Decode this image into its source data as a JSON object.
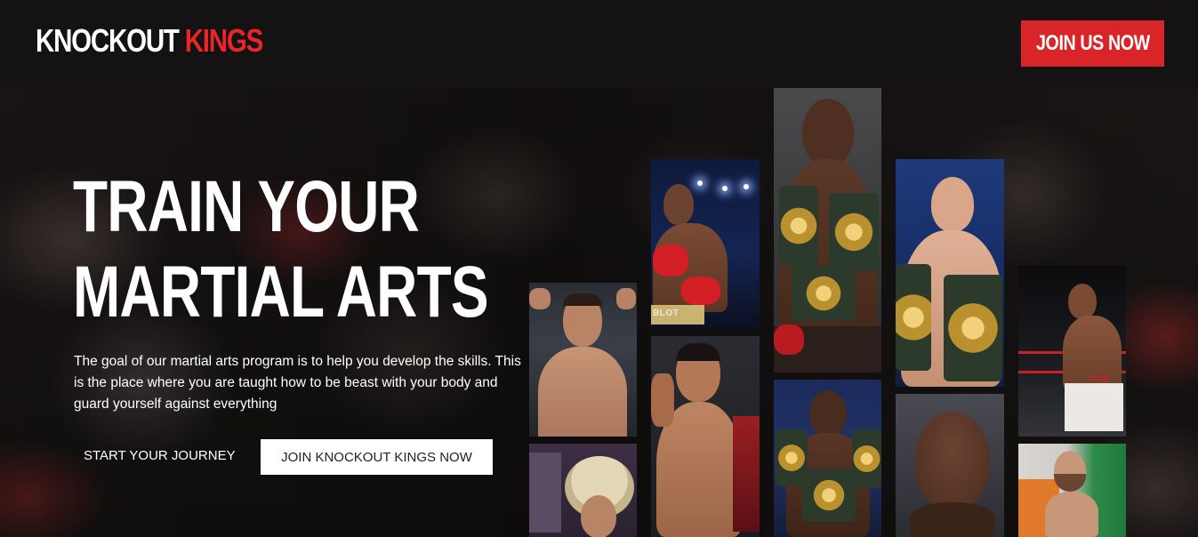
{
  "brand": {
    "logo_part1": "KNOCKOUT",
    "logo_part2": "KINGS",
    "accent_color": "#d92528"
  },
  "header": {
    "join_label": "JOIN US NOW"
  },
  "hero": {
    "title_line1": "TRAIN YOUR",
    "title_line2": "MARTIAL ARTS",
    "description": "The goal of our martial arts program is to help you develop the skills. This is the place where you are taught how to be beast with your body and guard yourself against everything",
    "cta_primary": "START YOUR JOURNEY",
    "cta_secondary": "JOIN KNOCKOUT KINGS NOW"
  },
  "gallery": {
    "images": [
      {
        "name": "fighter-photo-1"
      },
      {
        "name": "fighter-photo-2"
      },
      {
        "name": "fighter-photo-3"
      },
      {
        "name": "fighter-photo-4"
      },
      {
        "name": "fighter-photo-5"
      },
      {
        "name": "fighter-photo-6"
      },
      {
        "name": "fighter-photo-7"
      },
      {
        "name": "fighter-photo-8"
      },
      {
        "name": "fighter-photo-9"
      },
      {
        "name": "fighter-photo-10"
      },
      {
        "name": "fighter-photo-11"
      }
    ]
  }
}
